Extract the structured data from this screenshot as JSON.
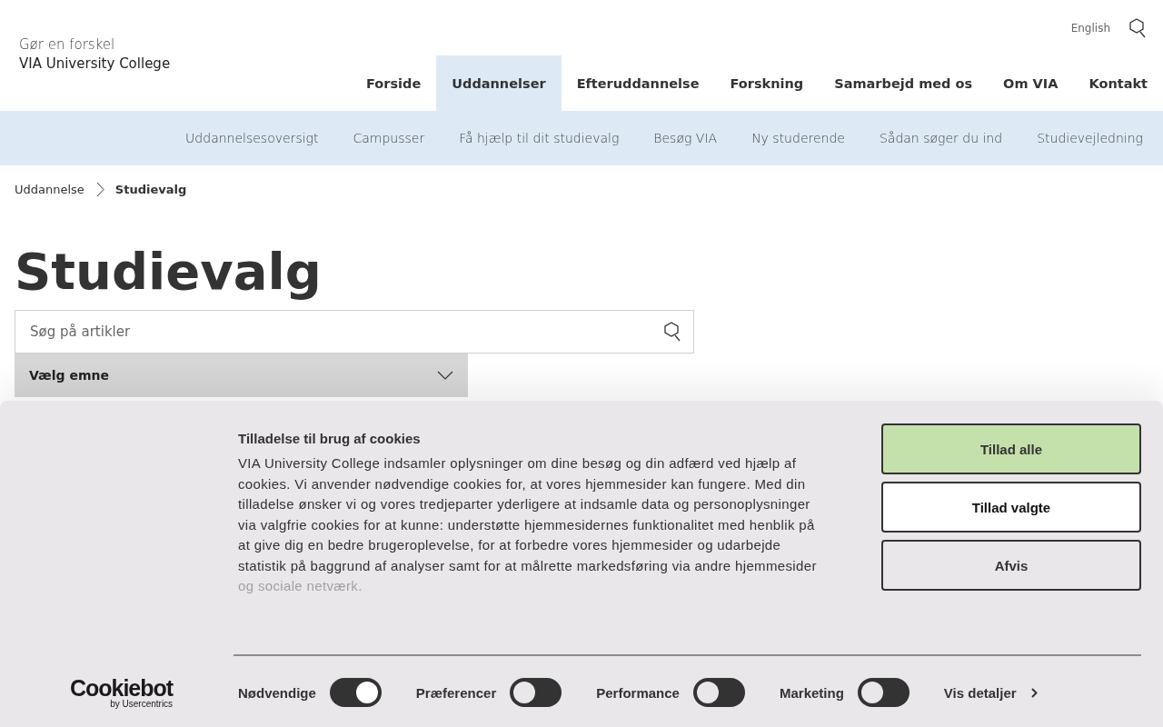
{
  "header": {
    "tagline": "Gør en forskel",
    "name": "VIA University College",
    "language_link": "English"
  },
  "main_nav": [
    {
      "label": "Forside",
      "selected": false
    },
    {
      "label": "Uddannelser",
      "selected": true
    },
    {
      "label": "Efteruddannelse",
      "selected": false
    },
    {
      "label": "Forskning",
      "selected": false
    },
    {
      "label": "Samarbejd med os",
      "selected": false
    },
    {
      "label": "Om VIA",
      "selected": false
    },
    {
      "label": "Kontakt",
      "selected": false
    }
  ],
  "sub_nav": [
    "Uddannelsesoversigt",
    "Campusser",
    "Få hjælp til dit studievalg",
    "Besøg VIA",
    "Ny studerende",
    "Sådan søger du ind",
    "Studievejledning"
  ],
  "breadcrumb": [
    "Uddannelse",
    "Studievalg"
  ],
  "page_title": "Studievalg",
  "search": {
    "placeholder": "Søg på artikler"
  },
  "topic_select": {
    "label": "Vælg emne"
  },
  "cookie_banner": {
    "logo": "Cookiebot",
    "logo_sub": "by Usercentrics",
    "title": "Tilladelse til brug af cookies",
    "body": "VIA University College indsamler oplysninger om dine besøg og din adfærd ved hjælp af cookies. Vi anvender nødvendige cookies for, at vores hjemmesider kan fungere. Med din tilladelse ønsker vi og vores tredjeparter yderligere at indsamle data og personoplysninger via valgfrie cookies for at kunne: understøtte hjemmesidernes funktionalitet med henblik på at give dig en bedre brugeroplevelse, for at forbedre vores hjemmesider og udarbejde statistik på baggrund af analyser samt for at målrette markedsføring via andre hjemmesider og sociale netværk.",
    "buttons": [
      {
        "label": "Tillad alle",
        "kind": "primary"
      },
      {
        "label": "Tillad valgte",
        "kind": "secondary"
      },
      {
        "label": "Afvis",
        "kind": "outline"
      }
    ],
    "toggles": [
      {
        "label": "Nødvendige",
        "checked": true
      },
      {
        "label": "Præferencer",
        "checked": false
      },
      {
        "label": "Performance",
        "checked": false
      },
      {
        "label": "Marketing",
        "checked": false
      }
    ],
    "details_link": "Vis detaljer"
  }
}
